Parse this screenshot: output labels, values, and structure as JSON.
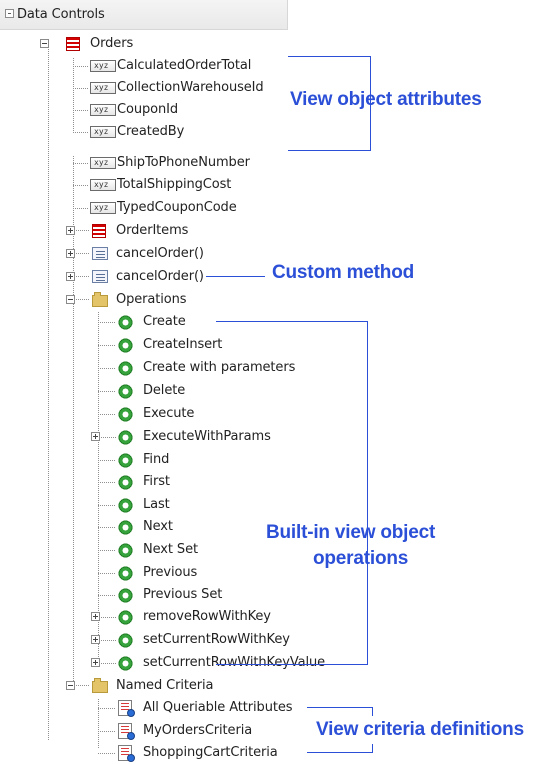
{
  "header": {
    "title": "Data Controls"
  },
  "tree": {
    "root": "Orders",
    "attributes_group_1": [
      "CalculatedOrderTotal",
      "CollectionWarehouseId",
      "CouponId",
      "CreatedBy"
    ],
    "attributes_group_2": [
      "ShipToPhoneNumber",
      "TotalShippingCost",
      "TypedCouponCode"
    ],
    "children": [
      "OrderItems",
      "cancelOrder()",
      "cancelOrder()",
      "Operations",
      "Named Criteria"
    ],
    "operations": [
      "Create",
      "CreateInsert",
      "Create with parameters",
      "Delete",
      "Execute",
      "ExecuteWithParams",
      "Find",
      "First",
      "Last",
      "Next",
      "Next Set",
      "Previous",
      "Previous Set",
      "removeRowWithKey",
      "setCurrentRowWithKey",
      "setCurrentRowWithKeyValue"
    ],
    "criteria": [
      "All Queriable Attributes",
      "MyOrdersCriteria",
      "ShoppingCartCriteria"
    ]
  },
  "annotations": {
    "view_object_attributes": "View object attributes",
    "custom_method": "Custom method",
    "built_in_operations_line1": "Built-in view object",
    "built_in_operations_line2": "operations",
    "view_criteria_definitions": "View criteria definitions"
  },
  "icons": {
    "attribute": "attribute-icon",
    "view_object": "view-object-icon",
    "method": "method-icon",
    "folder": "folder-icon",
    "operation": "operation-gear-icon",
    "criteria": "criteria-icon"
  },
  "colors": {
    "annotation": "#2b4fd7",
    "tree_text": "#222222"
  }
}
